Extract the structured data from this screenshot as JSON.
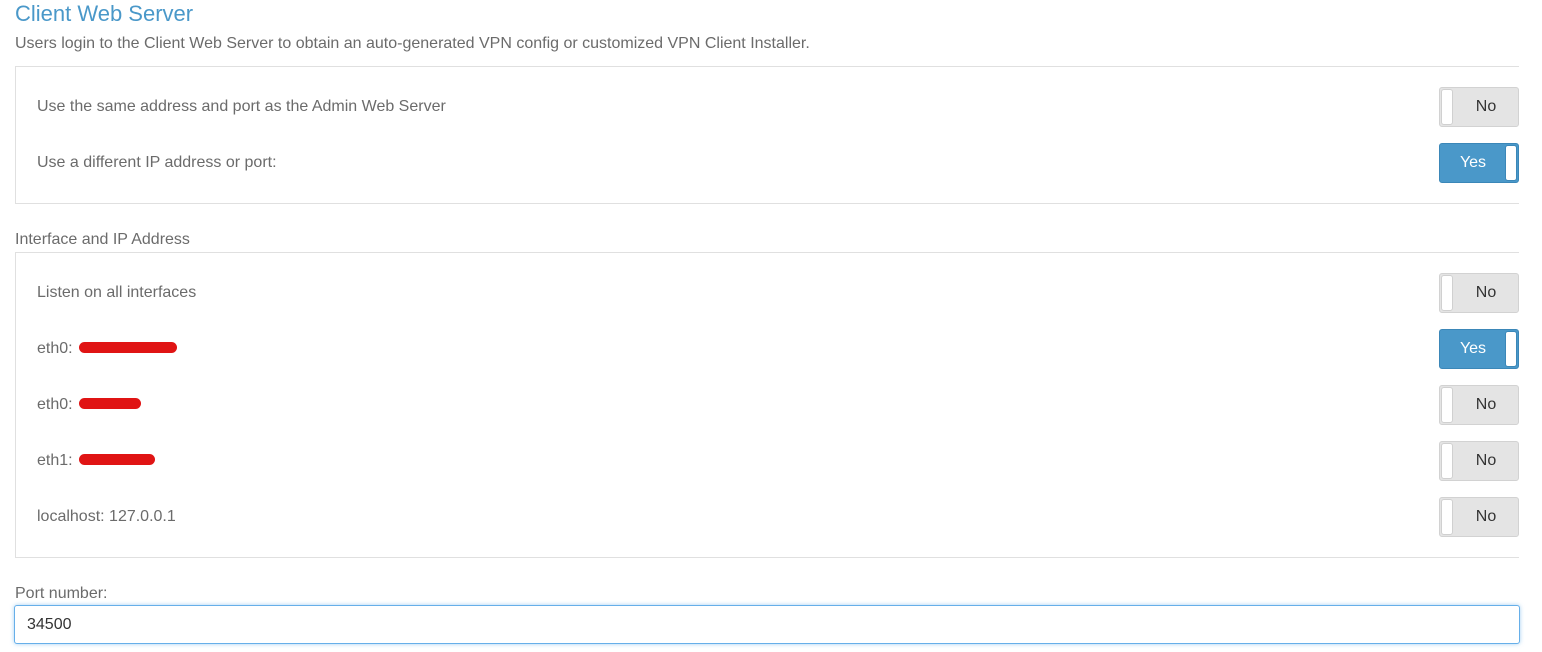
{
  "section": {
    "title": "Client Web Server",
    "description": "Users login to the Client Web Server to obtain an auto-generated VPN config or customized VPN Client Installer."
  },
  "address_options": [
    {
      "label": "Use the same address and port as the Admin Web Server",
      "value": "No",
      "on": false
    },
    {
      "label": "Use a different IP address or port:",
      "value": "Yes",
      "on": true
    }
  ],
  "interface_section": {
    "heading": "Interface and IP Address",
    "items": [
      {
        "label": "Listen on all interfaces",
        "value": "No",
        "on": false
      },
      {
        "label": "eth0:",
        "value": "Yes",
        "on": true,
        "redacted": true
      },
      {
        "label": "eth0:",
        "value": "No",
        "on": false,
        "redacted": true
      },
      {
        "label": "eth1:",
        "value": "No",
        "on": false,
        "redacted": true
      },
      {
        "label": "localhost: 127.0.0.1",
        "value": "No",
        "on": false
      }
    ]
  },
  "port": {
    "label": "Port number:",
    "value": "34500"
  },
  "colors": {
    "accent": "#4a98c9",
    "toggle_off": "#e4e4e4",
    "redaction": "#e01414"
  }
}
